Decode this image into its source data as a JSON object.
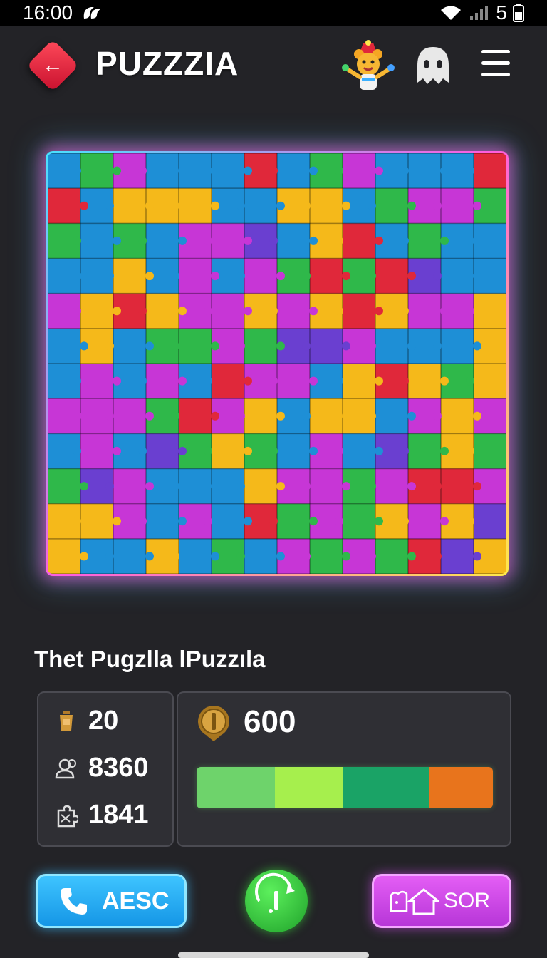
{
  "status_bar": {
    "time": "16:00",
    "battery": "5"
  },
  "app": {
    "title": "PUZZZIA"
  },
  "icons": {
    "back": "arrow-left-icon",
    "mascot": "mascot-avatar-icon",
    "ghost": "ghost-icon",
    "menu": "hamburger-menu-icon"
  },
  "puzzle": {
    "name": "Thet Pugzlla lPuzzıla",
    "grid_columns": 14,
    "grid_rows": 12,
    "piece_colors": [
      "#1e8fd6",
      "#c736d6",
      "#f5b91a",
      "#2fb84a",
      "#e0283a",
      "#6a3fd0"
    ]
  },
  "stats": {
    "trophy_count": "20",
    "players_count": "8360",
    "pieces_count": "1841"
  },
  "score": {
    "coins": "600",
    "progress_segments": [
      {
        "color": "#6ed36b",
        "share": 0.265
      },
      {
        "color": "#a6ef4d",
        "share": 0.23
      },
      {
        "color": "#1aa366",
        "share": 0.29
      },
      {
        "color": "#e8741c",
        "share": 0.215
      }
    ]
  },
  "buttons": {
    "aesc_label": "AESC",
    "sor_label": "SOR"
  },
  "colors": {
    "background": "#232327",
    "back_button": "#e0283a",
    "aesc_button": "#29aef5",
    "timer_button": "#2fc43a",
    "sor_button": "#cc4ae6"
  }
}
